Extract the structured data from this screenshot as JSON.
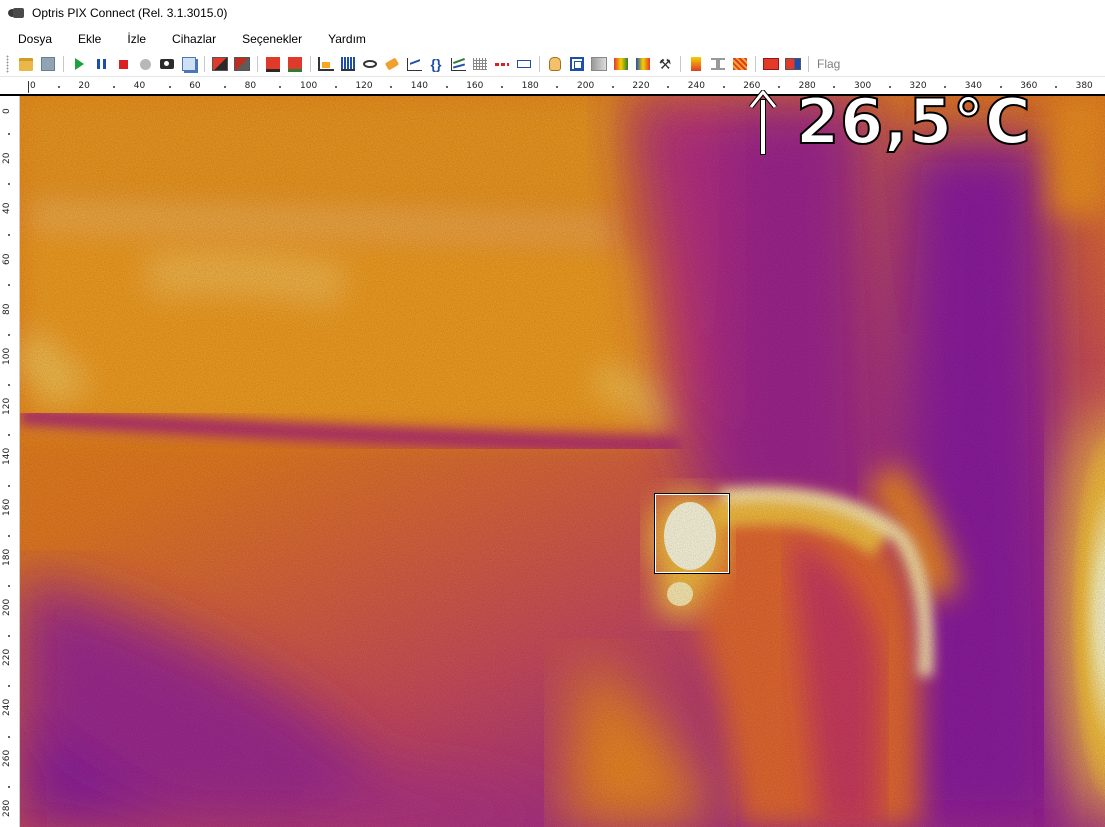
{
  "window": {
    "title": "Optris PIX Connect (Rel. 3.1.3015.0)",
    "app_icon": "camera-icon"
  },
  "menu": {
    "items": [
      "Dosya",
      "Ekle",
      "İzle",
      "Cihazlar",
      "Seçenekler",
      "Yardım"
    ]
  },
  "toolbar": {
    "buttons": [
      {
        "name": "open-folder-icon",
        "cls": "folder"
      },
      {
        "name": "save-icon",
        "cls": "save"
      },
      {
        "sep": true
      },
      {
        "name": "play-icon",
        "cls": "play"
      },
      {
        "name": "pause-icon",
        "cls": "pause"
      },
      {
        "name": "stop-icon",
        "cls": "stop"
      },
      {
        "name": "record-icon",
        "cls": "rec"
      },
      {
        "name": "snapshot-camera-icon",
        "cls": "cam"
      },
      {
        "name": "copy-icon",
        "cls": "copy"
      },
      {
        "sep": true
      },
      {
        "name": "snapshot-image-icon",
        "cls": "img-red"
      },
      {
        "name": "snapshot-image-alt-icon",
        "cls": "img-red2"
      },
      {
        "sep": true
      },
      {
        "name": "mark-measure-icon",
        "cls": "mark"
      },
      {
        "name": "mark-measure-alt-icon",
        "cls": "mark2"
      },
      {
        "sep": true
      },
      {
        "name": "chart-icon",
        "cls": "chart-ico"
      },
      {
        "name": "histogram-icon",
        "cls": "histo"
      },
      {
        "name": "view-icon",
        "cls": "eye"
      },
      {
        "name": "tag-icon",
        "cls": "tag"
      },
      {
        "name": "line-profile-icon",
        "cls": "line-ico"
      },
      {
        "name": "brace-icon",
        "cls": "brace",
        "glyph": "{}"
      },
      {
        "name": "multi-line-chart-icon",
        "cls": "multi"
      },
      {
        "name": "grid-icon",
        "cls": "grid-ico"
      },
      {
        "name": "dashed-line-icon",
        "cls": "dash"
      },
      {
        "name": "ruler-icon",
        "cls": "ruler"
      },
      {
        "sep": true
      },
      {
        "name": "hand-pan-icon",
        "cls": "hand"
      },
      {
        "name": "fit-to-window-icon",
        "cls": "fit"
      },
      {
        "name": "grayscale-icon",
        "cls": "gray"
      },
      {
        "name": "palette-icon",
        "cls": "pal1"
      },
      {
        "name": "palette-alt-icon",
        "cls": "pal2"
      },
      {
        "name": "tools-icon",
        "cls": "tools",
        "glyph": "⚒"
      },
      {
        "sep": true
      },
      {
        "name": "color-bar-icon",
        "cls": "bar-ico"
      },
      {
        "name": "temperature-range-icon",
        "cls": "tbar"
      },
      {
        "name": "isotherm-icon",
        "cls": "stripe"
      },
      {
        "sep": true
      },
      {
        "name": "alarm-box-icon",
        "cls": "ibox1"
      },
      {
        "name": "alarm-box-alt-icon",
        "cls": "ibox2"
      },
      {
        "sep": true
      }
    ],
    "flag_label": "Flag"
  },
  "ruler_top": {
    "labels": [
      "0",
      "20",
      "40",
      "60",
      "80",
      "100",
      "120",
      "140",
      "160",
      "180",
      "200",
      "220",
      "240",
      "260",
      "280",
      "300",
      "320",
      "340",
      "360",
      "380"
    ]
  },
  "ruler_left": {
    "labels": [
      "0",
      "20",
      "40",
      "60",
      "80",
      "100",
      "120",
      "140",
      "160",
      "180",
      "200",
      "220",
      "240",
      "260",
      "280"
    ]
  },
  "thermal": {
    "max_temperature": "26,5°C",
    "palette_colors": [
      "#8a1fa0",
      "#c0208a",
      "#e06028",
      "#f08a18",
      "#f8b838",
      "#fff4c0"
    ]
  }
}
